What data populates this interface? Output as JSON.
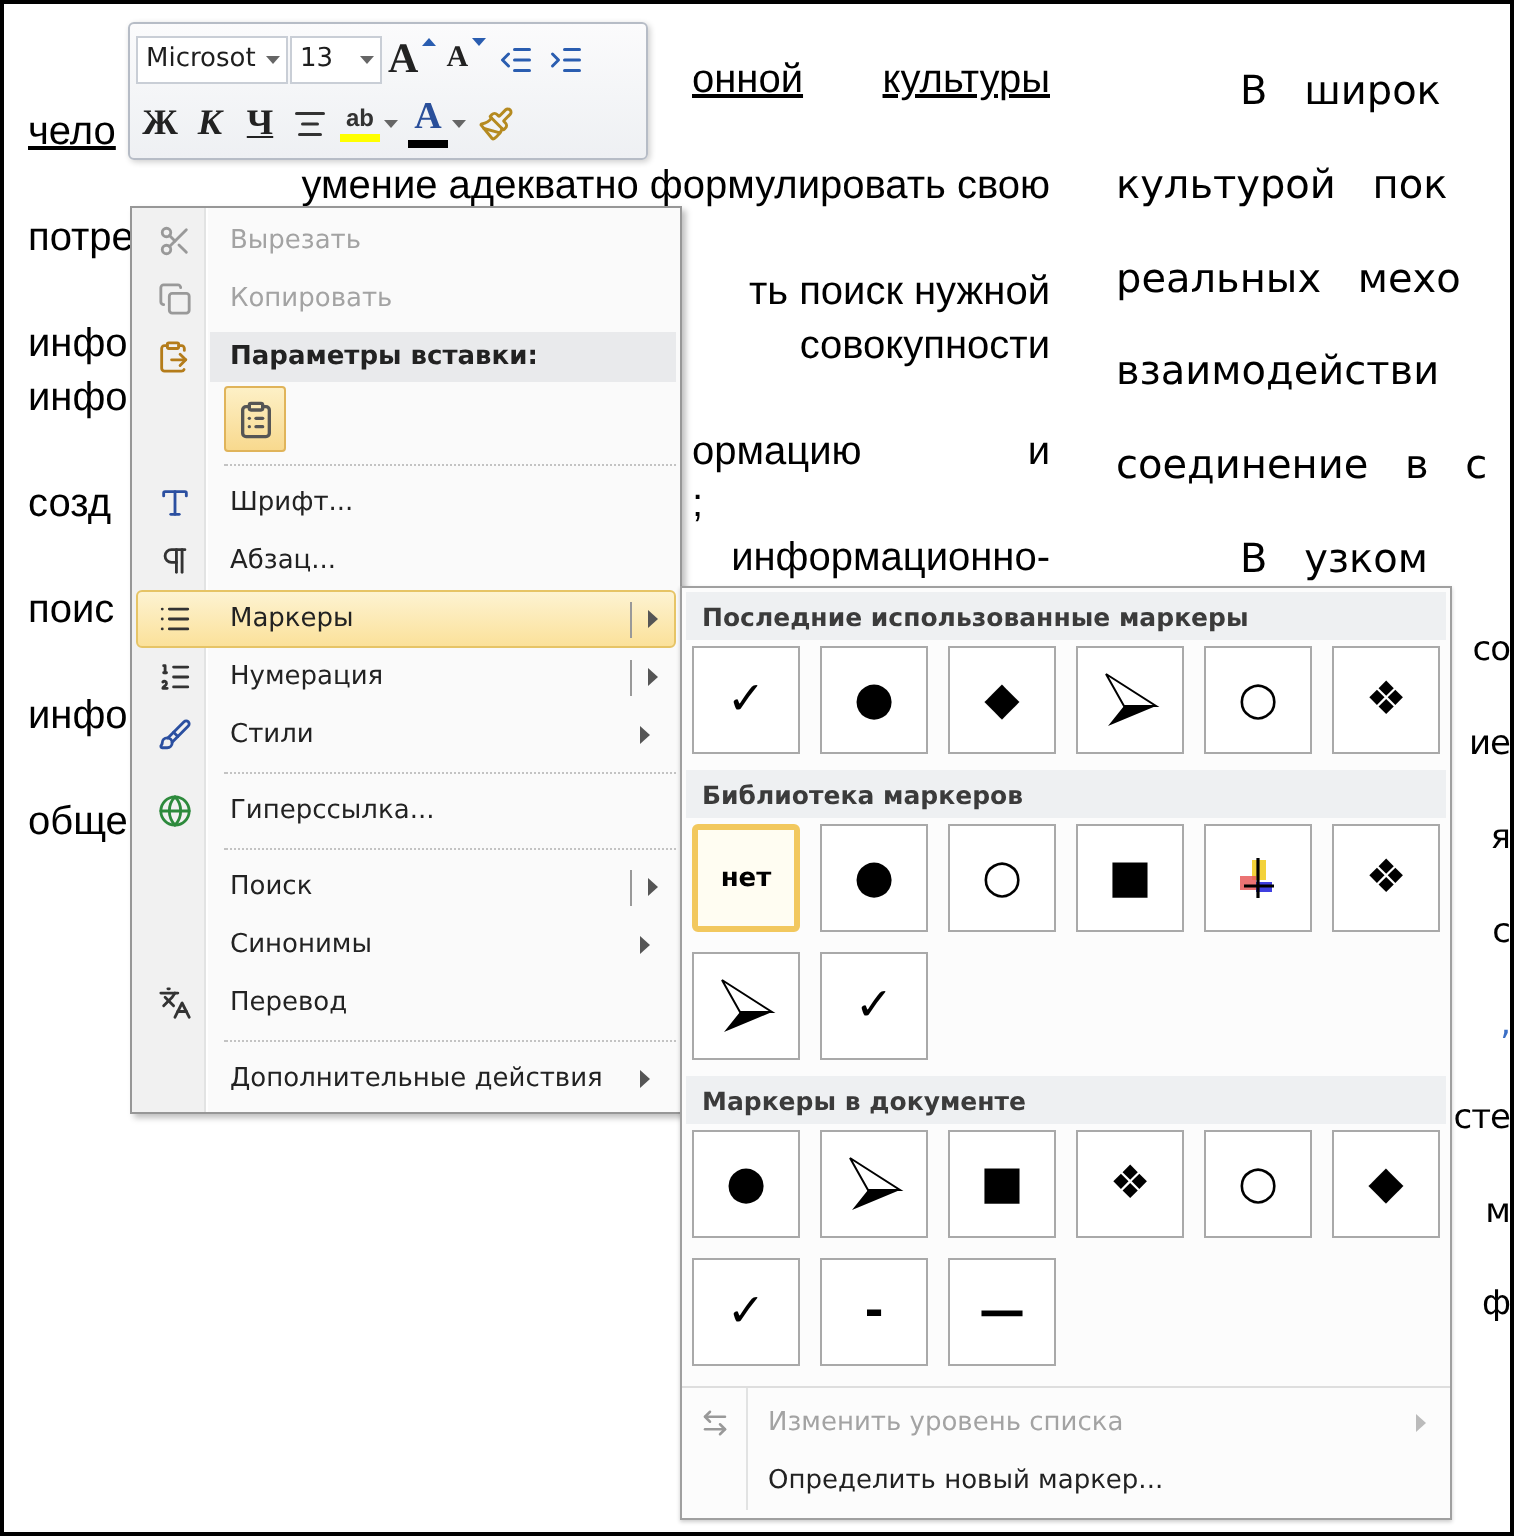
{
  "document": {
    "left_lines": [
      {
        "kind": "spread",
        "tail": [
          "онной",
          "культуры"
        ],
        "underlined": true
      },
      {
        "kind": "plain",
        "lead": "чело",
        "underlined": true
      },
      {
        "kind": "right",
        "tail": [
          "умение адекватно формулировать свою"
        ],
        "underlined": false
      },
      {
        "kind": "plain",
        "lead": "потре",
        "underlined": false
      },
      {
        "kind": "right",
        "tail": [
          "ть поиск нужной"
        ],
        "underlined": false
      },
      {
        "kind": "right",
        "lead": "инфо",
        "tail": [
          "совокупности"
        ],
        "underlined": false
      },
      {
        "kind": "plain",
        "lead": "инфо",
        "underlined": false
      },
      {
        "kind": "spread",
        "tail": [
          "ормацию",
          "и"
        ],
        "underlined": false
      },
      {
        "kind": "left",
        "lead": "созд",
        "tail": [
          ";"
        ],
        "underlined": false
      },
      {
        "kind": "right",
        "tail": [
          "информационно-"
        ],
        "underlined": false
      },
      {
        "kind": "plain",
        "lead": "поис",
        "underlined": false
      },
      {
        "kind": "blank"
      },
      {
        "kind": "plain",
        "lead": "инфо",
        "underlined": false
      },
      {
        "kind": "blank"
      },
      {
        "kind": "plain",
        "lead": "обще",
        "underlined": false
      }
    ],
    "right_lines": [
      {
        "kind": "first",
        "text": "В широк",
        "color": "#000000"
      },
      {
        "kind": "line",
        "text": "культурой пок",
        "color": "#000000"
      },
      {
        "kind": "line",
        "text": "реальных мехо",
        "color": "#000000"
      },
      {
        "kind": "line",
        "text": "взаимодействи",
        "color": "#000000"
      },
      {
        "kind": "line",
        "text": "соединение в с",
        "color": "#000000"
      },
      {
        "kind": "first",
        "text": "В узком",
        "color": "#000000"
      },
      {
        "kind": "edge",
        "text": "со",
        "color": "#000000"
      },
      {
        "kind": "edge",
        "text": "ие",
        "color": "#000000"
      },
      {
        "kind": "edge",
        "text": "я",
        "color": "#000000"
      },
      {
        "kind": "edge",
        "text": "с",
        "color": "#000000"
      },
      {
        "kind": "edge",
        "text": ",",
        "color": "#3b6fc6"
      },
      {
        "kind": "edge",
        "text": "сте",
        "color": "#000000"
      },
      {
        "kind": "edge",
        "text": "м",
        "color": "#000000"
      },
      {
        "kind": "edge",
        "text": "ф",
        "color": "#000000"
      }
    ]
  },
  "mini_toolbar": {
    "font": "Microsot",
    "size": "13",
    "row_1": [
      {
        "kind": "grow",
        "label": "A"
      },
      {
        "kind": "shrink",
        "label": "A"
      },
      {
        "kind": "outdent"
      },
      {
        "kind": "indent"
      }
    ],
    "row_2": [
      {
        "kind": "bold",
        "label": "Ж"
      },
      {
        "kind": "italic",
        "label": "К"
      },
      {
        "kind": "underline",
        "label": "Ч"
      },
      {
        "kind": "center"
      },
      {
        "kind": "highlight",
        "label": "ab",
        "color": "#ffff00"
      },
      {
        "kind": "fontcolor",
        "label": "A",
        "color": "#000000"
      },
      {
        "kind": "painter"
      }
    ]
  },
  "context_menu": {
    "items": [
      {
        "kind": "item",
        "label": "Вырезать",
        "disabled": true,
        "selected": false,
        "submenu": false
      },
      {
        "kind": "item",
        "label": "Копировать",
        "disabled": true,
        "selected": false,
        "submenu": false
      },
      {
        "kind": "header",
        "label": "Параметры вставки:"
      },
      {
        "kind": "paste"
      },
      {
        "kind": "separator"
      },
      {
        "kind": "item",
        "label": "Шрифт...",
        "disabled": false,
        "selected": false,
        "submenu": false
      },
      {
        "kind": "item",
        "label": "Абзац...",
        "disabled": false,
        "selected": false,
        "submenu": false
      },
      {
        "kind": "item",
        "label": "Маркеры",
        "disabled": false,
        "selected": true,
        "submenu": true,
        "split": true
      },
      {
        "kind": "item",
        "label": "Нумерация",
        "disabled": false,
        "selected": false,
        "submenu": true,
        "split": true
      },
      {
        "kind": "item",
        "label": "Стили",
        "disabled": false,
        "selected": false,
        "submenu": true,
        "split": false
      },
      {
        "kind": "separator"
      },
      {
        "kind": "item",
        "label": "Гиперссылка...",
        "disabled": false,
        "selected": false,
        "submenu": false
      },
      {
        "kind": "separator"
      },
      {
        "kind": "item",
        "label": "Поиск",
        "disabled": false,
        "selected": false,
        "submenu": true,
        "split": true
      },
      {
        "kind": "item",
        "label": "Синонимы",
        "disabled": false,
        "selected": false,
        "submenu": true,
        "split": false
      },
      {
        "kind": "item",
        "label": "Перевод",
        "disabled": false,
        "selected": false,
        "submenu": false
      },
      {
        "kind": "separator"
      },
      {
        "kind": "item",
        "label": "Дополнительные действия",
        "disabled": false,
        "selected": false,
        "submenu": true,
        "split": false
      }
    ]
  },
  "bullet_menu": {
    "sections": [
      {
        "title": "Последние использованные маркеры",
        "tiles": [
          {
            "kind": "glyph",
            "symbol": "✓",
            "selected": false
          },
          {
            "kind": "glyph",
            "symbol": "●",
            "selected": false
          },
          {
            "kind": "glyph",
            "symbol": "◆",
            "selected": false
          },
          {
            "kind": "arrow",
            "selected": false
          },
          {
            "kind": "glyph",
            "symbol": "○",
            "selected": false
          },
          {
            "kind": "glyph",
            "symbol": "❖",
            "selected": false
          }
        ]
      },
      {
        "title": "Библиотека маркеров",
        "tiles": [
          {
            "kind": "label",
            "symbol": "нет",
            "selected": true
          },
          {
            "kind": "glyph",
            "symbol": "●",
            "selected": false
          },
          {
            "kind": "glyph",
            "symbol": "○",
            "selected": false
          },
          {
            "kind": "glyph",
            "symbol": "■",
            "selected": false
          },
          {
            "kind": "image",
            "selected": false
          },
          {
            "kind": "glyph",
            "symbol": "❖",
            "selected": false
          },
          {
            "kind": "arrow",
            "selected": false
          },
          {
            "kind": "glyph",
            "symbol": "✓",
            "selected": false
          }
        ]
      },
      {
        "title": "Маркеры в документе",
        "tiles": [
          {
            "kind": "glyph",
            "symbol": "●",
            "selected": false
          },
          {
            "kind": "arrow",
            "selected": false
          },
          {
            "kind": "glyph",
            "symbol": "■",
            "selected": false
          },
          {
            "kind": "glyph",
            "symbol": "❖",
            "selected": false
          },
          {
            "kind": "glyph",
            "symbol": "○",
            "selected": false
          },
          {
            "kind": "glyph",
            "symbol": "◆",
            "selected": false
          },
          {
            "kind": "glyph",
            "symbol": "✓",
            "selected": false
          },
          {
            "kind": "glyph",
            "symbol": "-",
            "selected": false
          },
          {
            "kind": "glyph",
            "symbol": "—",
            "selected": false
          }
        ]
      }
    ],
    "items": [
      {
        "label": "Изменить уровень списка",
        "disabled": true,
        "submenu": true
      },
      {
        "label": "Определить новый маркер...",
        "disabled": false,
        "submenu": false
      }
    ]
  }
}
